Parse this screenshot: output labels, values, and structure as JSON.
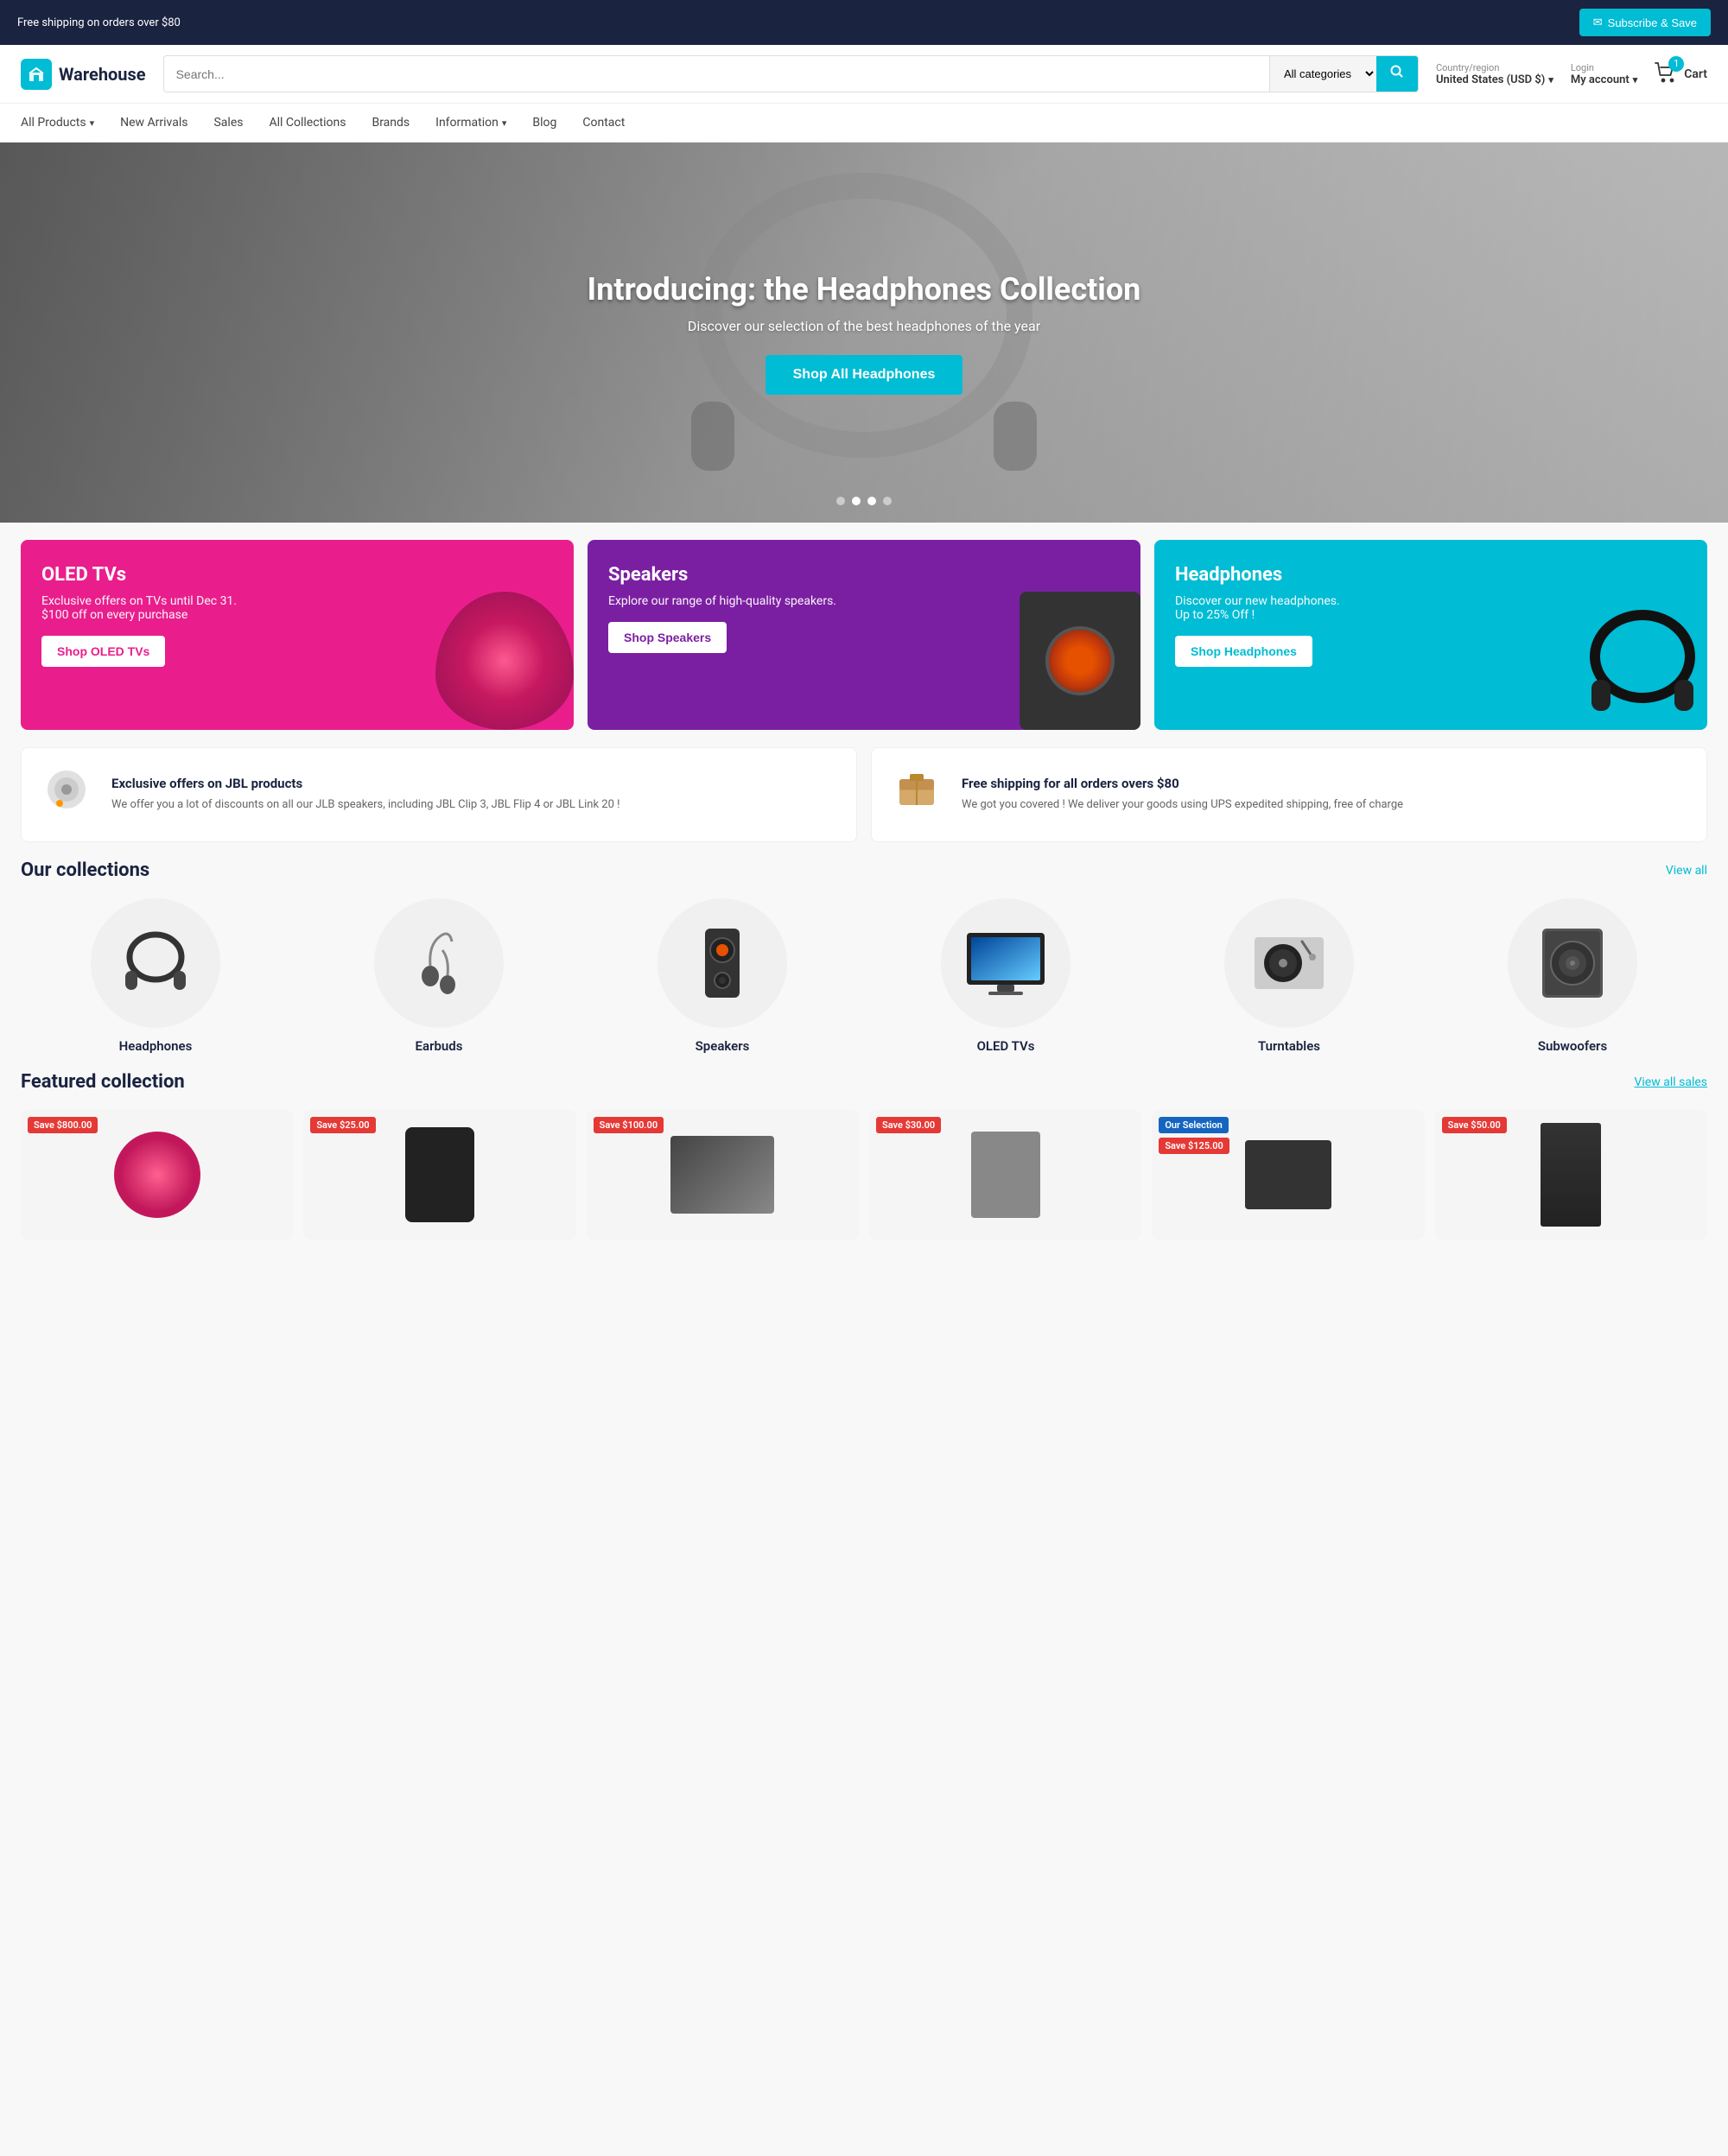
{
  "topBanner": {
    "shipping_text": "Free shipping on orders over $80",
    "subscribe_label": "Subscribe & Save",
    "subscribe_icon": "✉"
  },
  "header": {
    "logo_text": "Warehouse",
    "logo_icon": "🏬",
    "search_placeholder": "Search...",
    "category_label": "All categories",
    "country_label": "Country/region",
    "country_value": "United States (USD $)",
    "login_label": "Login",
    "account_label": "My account",
    "cart_label": "Cart",
    "cart_count": "1"
  },
  "nav": {
    "items": [
      {
        "label": "All Products",
        "has_dropdown": true
      },
      {
        "label": "New Arrivals",
        "has_dropdown": false
      },
      {
        "label": "Sales",
        "has_dropdown": false
      },
      {
        "label": "All Collections",
        "has_dropdown": false
      },
      {
        "label": "Brands",
        "has_dropdown": false
      },
      {
        "label": "Information",
        "has_dropdown": true
      },
      {
        "label": "Blog",
        "has_dropdown": false
      },
      {
        "label": "Contact",
        "has_dropdown": false
      }
    ]
  },
  "hero": {
    "title": "Introducing: the Headphones Collection",
    "subtitle": "Discover our selection of the best headphones of the year",
    "cta_label": "Shop All Headphones",
    "dots": 4,
    "active_dot": 2
  },
  "promoCards": [
    {
      "title": "OLED TVs",
      "description": "Exclusive offers on TVs until Dec 31.\n$100 off on every purchase",
      "btn_label": "Shop OLED TVs",
      "color": "pink"
    },
    {
      "title": "Speakers",
      "description": "Explore our range of high-quality speakers.",
      "btn_label": "Shop Speakers",
      "color": "purple"
    },
    {
      "title": "Headphones",
      "description": "Discover our new headphones.\nUp to 25% Off !",
      "btn_label": "Shop Headphones",
      "color": "cyan"
    }
  ],
  "infoBanners": [
    {
      "icon": "🔊",
      "title": "Exclusive offers on JBL products",
      "description": "We offer you a lot of discounts on all our JLB speakers, including JBL Clip 3, JBL Flip 4 or JBL Link 20 !"
    },
    {
      "icon": "📦",
      "title": "Free shipping for all orders overs $80",
      "description": "We got you covered ! We deliver your goods using UPS expedited shipping, free of charge"
    }
  ],
  "collections": {
    "heading": "Our collections",
    "view_all_label": "View all",
    "items": [
      {
        "label": "Headphones",
        "emoji": "🎧"
      },
      {
        "label": "Earbuds",
        "emoji": "🎵"
      },
      {
        "label": "Speakers",
        "emoji": "🔊"
      },
      {
        "label": "OLED TVs",
        "emoji": "📺"
      },
      {
        "label": "Turntables",
        "emoji": "💿"
      },
      {
        "label": "Subwoofers",
        "emoji": "🔈"
      }
    ]
  },
  "featured": {
    "heading": "Featured collection",
    "view_all_label": "View all sales",
    "products": [
      {
        "badge": "Save $800.00",
        "badge_color": "red"
      },
      {
        "badge": "Save $25.00",
        "badge_color": "red"
      },
      {
        "badge": "Save $100.00",
        "badge_color": "red"
      },
      {
        "badge": "Save $30.00",
        "badge_color": "red"
      },
      {
        "badge": "Our Selection",
        "badge_color": "blue",
        "sub_badge": "Save $125.00"
      },
      {
        "badge": "Save $50.00",
        "badge_color": "red"
      }
    ]
  }
}
